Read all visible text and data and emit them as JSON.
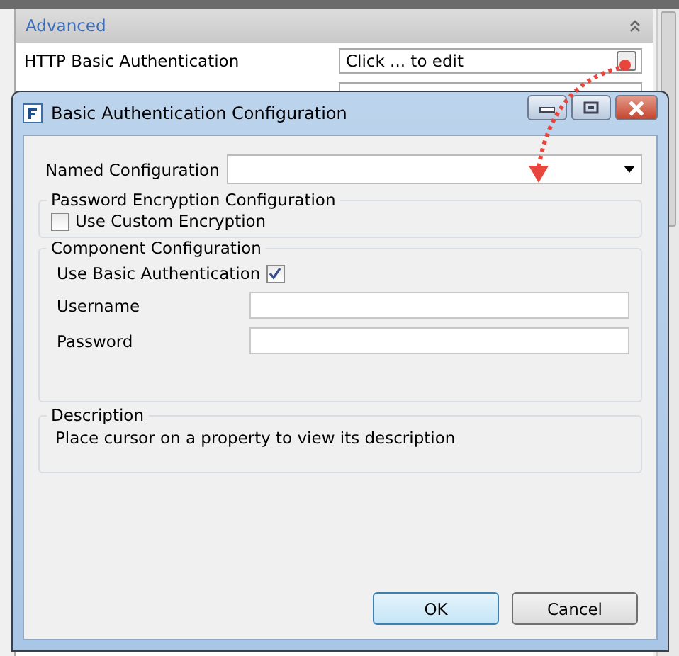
{
  "background_panel": {
    "section": {
      "title": "Advanced",
      "expanded": true
    },
    "rows": [
      {
        "label": "HTTP Basic Authentication",
        "value": "Click ... to edit"
      }
    ]
  },
  "dialog": {
    "title": "Basic Authentication Configuration",
    "named_configuration": {
      "label": "Named Configuration"
    },
    "groups": [
      {
        "title": "Password Encryption Configuration",
        "fields": [
          {
            "kind": "checkbox",
            "label": "Use Custom Encryption",
            "checked": false
          }
        ]
      },
      {
        "title": "Component Configuration",
        "fields": [
          {
            "kind": "checkbox-right",
            "label": "Use Basic Authentication",
            "checked": true
          },
          {
            "kind": "text",
            "label": "Username"
          },
          {
            "kind": "text",
            "label": "Password"
          }
        ]
      }
    ],
    "description": {
      "title": "Description",
      "text": "Place cursor on a property to view its description"
    },
    "buttons": [
      {
        "label": "OK",
        "default": true
      },
      {
        "label": "Cancel",
        "default": false
      }
    ]
  }
}
